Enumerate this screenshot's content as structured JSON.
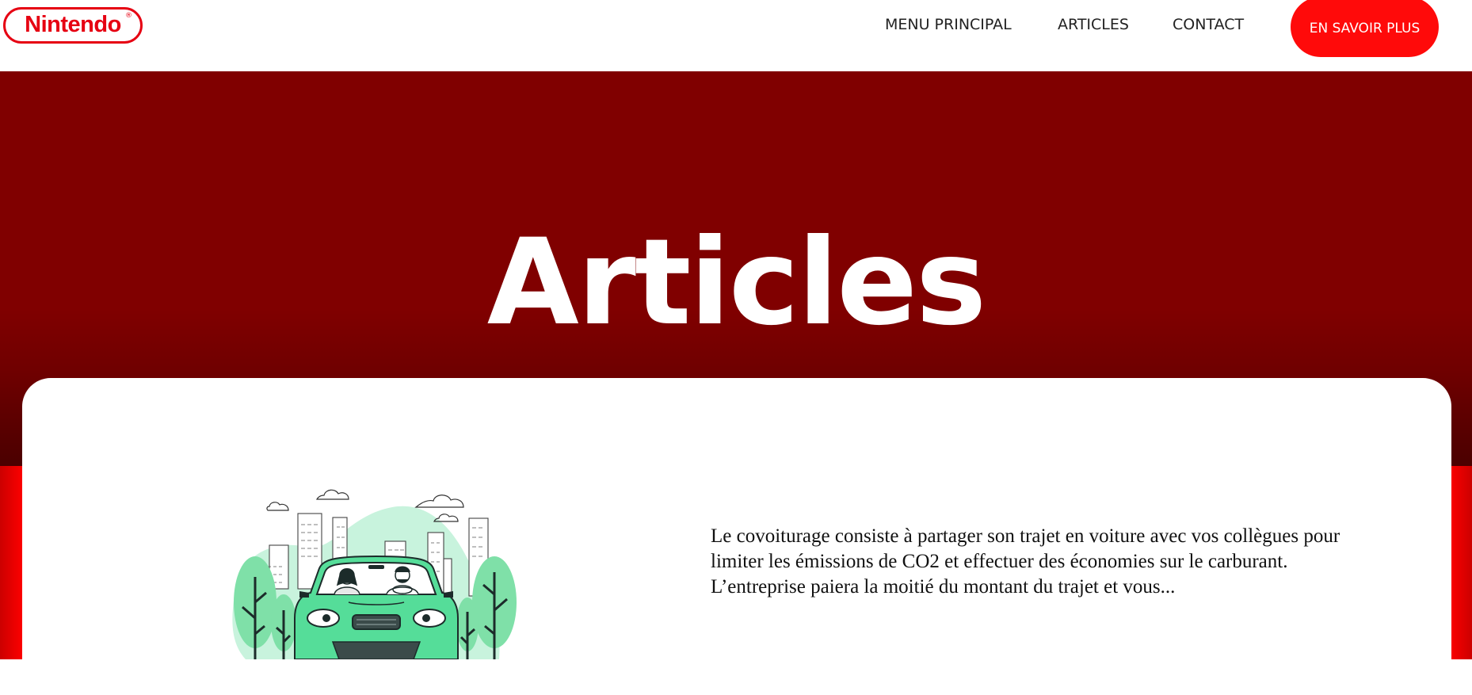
{
  "brand": {
    "logo_text": "Nintendo",
    "logo_mark": "®",
    "color": "#e60012"
  },
  "nav": {
    "items": [
      {
        "label": "MENU PRINCIPAL"
      },
      {
        "label": "ARTICLES"
      },
      {
        "label": "CONTACT"
      }
    ],
    "cta_label": "EN SAVOIR PLUS",
    "cta_color": "#ff0a0a"
  },
  "hero": {
    "title": "Articles",
    "background": "#800000"
  },
  "article": {
    "illustration": "carpool-car-city-illustration",
    "excerpt": "Le covoiturage consiste à partager son trajet en voiture avec vos collègues pour limiter les émissions de CO2 et effectuer des économies sur le carburant. L’entreprise paiera la moitié du montant du trajet et vous..."
  },
  "colors": {
    "accent_red": "#ff0000",
    "illustration_green": "#5ee0a0",
    "illustration_light": "#c8f3dd"
  }
}
